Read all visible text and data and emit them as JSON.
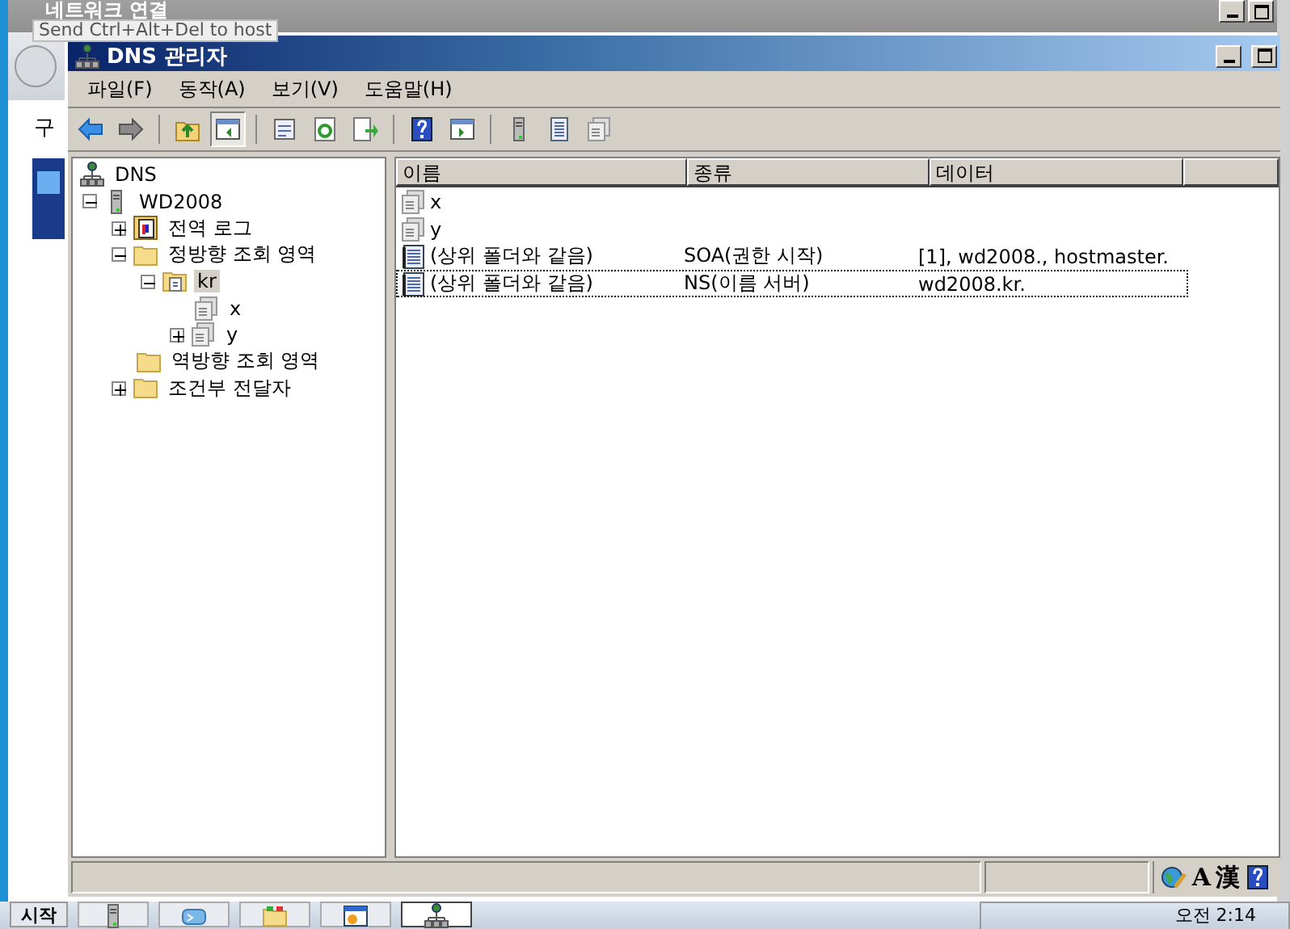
{
  "outer_window": {
    "title": "네트워크 연결",
    "toolbar_label": "구"
  },
  "tooltip": {
    "text": "Send Ctrl+Alt+Del to host"
  },
  "window": {
    "title": "DNS 관리자"
  },
  "menu": [
    "파일(F)",
    "동작(A)",
    "보기(V)",
    "도움말(H)"
  ],
  "toolbar": [
    {
      "kind": "back",
      "pressed": false
    },
    {
      "kind": "forward",
      "pressed": false
    },
    {
      "kind": "up",
      "pressed": false
    },
    {
      "kind": "tree",
      "pressed": true
    },
    {
      "kind": "properties",
      "pressed": false
    },
    {
      "kind": "refresh",
      "pressed": false
    },
    {
      "kind": "export",
      "pressed": false
    },
    {
      "kind": "help",
      "pressed": false
    },
    {
      "kind": "pane",
      "pressed": false
    },
    {
      "kind": "server",
      "pressed": false
    },
    {
      "kind": "list",
      "pressed": false
    },
    {
      "kind": "copy",
      "pressed": false
    }
  ],
  "tree": [
    {
      "label": "DNS",
      "kind": "dns",
      "selected": false,
      "children": [
        {
          "label": "WD2008",
          "kind": "server",
          "expanded": true,
          "selected": false,
          "children": [
            {
              "label": "전역 로그",
              "kind": "log",
              "expanded": false,
              "selected": false
            },
            {
              "label": "정방향 조회 영역",
              "kind": "folder",
              "expanded": true,
              "selected": false,
              "children": [
                {
                  "label": "kr",
                  "kind": "zone",
                  "expanded": true,
                  "selected": true,
                  "children": [
                    {
                      "label": "x",
                      "kind": "domain",
                      "selected": false
                    },
                    {
                      "label": "y",
                      "kind": "domain",
                      "expanded": false,
                      "selected": false
                    }
                  ]
                }
              ]
            },
            {
              "label": "역방향 조회 영역",
              "kind": "folder",
              "selected": false
            },
            {
              "label": "조건부 전달자",
              "kind": "folder",
              "expanded": false,
              "selected": false
            }
          ]
        }
      ]
    }
  ],
  "list": {
    "columns": [
      "이름",
      "종류",
      "데이터"
    ],
    "rows": [
      {
        "name": "x",
        "kind": "domain",
        "focused": false
      },
      {
        "name": "y",
        "kind": "domain",
        "focused": false
      },
      {
        "name": "(상위 폴더와 같음)",
        "type": "SOA(권한 시작)",
        "data": "[1], wd2008., hostmaster.",
        "kind": "record",
        "focused": false
      },
      {
        "name": "(상위 폴더와 같음)",
        "type": "NS(이름 서버)",
        "data": "wd2008.kr.",
        "kind": "record",
        "focused": true
      }
    ]
  },
  "status_icons": [
    {
      "kind": "globe"
    },
    {
      "kind": "text",
      "label": "A"
    },
    {
      "kind": "text",
      "label": "漢"
    },
    {
      "kind": "help"
    }
  ],
  "taskbar": {
    "start": "시작",
    "clock": "오전 2:14",
    "buttons": [
      {
        "kind": "server",
        "active": false
      },
      {
        "kind": "shell",
        "active": false
      },
      {
        "kind": "folders",
        "active": false
      },
      {
        "kind": "window",
        "active": false
      },
      {
        "kind": "dns",
        "active": true
      }
    ]
  }
}
